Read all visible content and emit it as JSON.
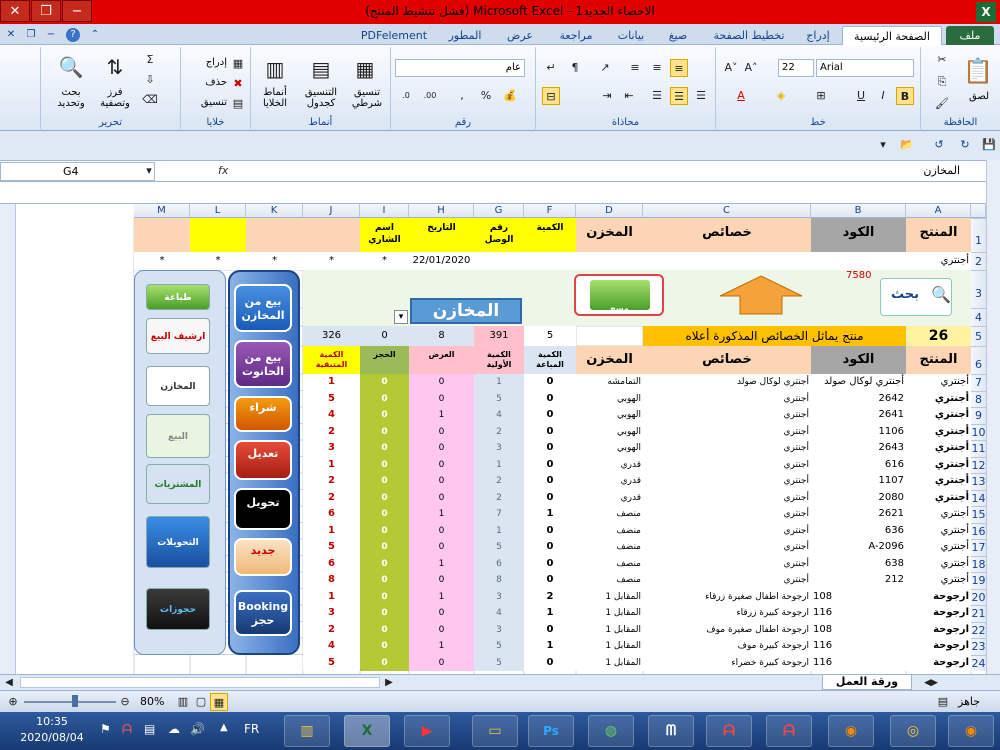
{
  "window": {
    "title": "الاحصاء الجديد1 - Microsoft Excel (فشل تنشيط المنتج)",
    "btn_close": "✕",
    "btn_restore": "❐",
    "btn_min": "−",
    "app_icon": "X"
  },
  "tabs": [
    "ملف",
    "الصفحة الرئيسية",
    "إدراج",
    "تخطيط الصفحة",
    "صيغ",
    "بيانات",
    "مراجعة",
    "عرض",
    "المطور",
    "PDFelement"
  ],
  "ribbon": {
    "clipboard": {
      "label": "الحافظة",
      "paste": "لصق"
    },
    "font": {
      "label": "خط",
      "name": "Arial",
      "size": "22"
    },
    "alignment": {
      "label": "محاذاة"
    },
    "number": {
      "label": "رقم",
      "format": "عام"
    },
    "styles": {
      "label": "أنماط",
      "cond": "تنسيق شرطي",
      "table": "التنسيق كجدول",
      "cell": "أنماط الخلايا"
    },
    "cells": {
      "label": "خلايا",
      "insert": "إدراج",
      "delete": "حذف",
      "format": "تنسيق"
    },
    "editing": {
      "label": "تحرير",
      "sort": "فرز وتصفية",
      "find": "بحث وتحديد"
    }
  },
  "formula_bar": {
    "name_box": "G4",
    "fx": "fx",
    "value": "المخازن"
  },
  "sheet": {
    "columns": [
      "A",
      "B",
      "C",
      "D",
      "F",
      "G",
      "H",
      "I",
      "J",
      "K",
      "L",
      "M"
    ],
    "row1": {
      "A": "المنتج",
      "B": "الكود",
      "C": "خصائص",
      "D": "المخزن",
      "F": "الكمية",
      "G": "رقم الوصل",
      "H": "التاريخ",
      "I": "اسم الشاري"
    },
    "row2": {
      "A": "أجنتري",
      "H": "22/01/2020",
      "I": "*",
      "J": "*",
      "K": "*",
      "L": "*",
      "M": "*"
    },
    "row3": {
      "code": "7580"
    },
    "store_title": "المخازن",
    "row5": {
      "A": "26",
      "B": "منتج يماثل الخصائص المذكورة أعلاه",
      "F": "5",
      "G": "391",
      "H": "8",
      "I": "0",
      "J": "326"
    },
    "headers": {
      "A": "المنتج",
      "B": "الكود",
      "C": "خصائص",
      "D": "المخزن",
      "F": "الكمية المباعة",
      "G": "الكمية الأولية",
      "H": "العرض",
      "I": "الحجز",
      "J": "الكمية المتبقية"
    },
    "rows": [
      {
        "n": "7",
        "A": "أجنتري",
        "B": "أجنتري لوكال صولد",
        "C": "أجنتري لوكال صولد",
        "D": "التمامشه",
        "F": "0",
        "G": "1",
        "H": "0",
        "I": "0",
        "J": "1"
      },
      {
        "n": "8",
        "A": "أجنتري",
        "B": "2642",
        "C": "أجنتري",
        "D": "الهوبي",
        "F": "0",
        "G": "5",
        "H": "0",
        "I": "0",
        "J": "5"
      },
      {
        "n": "9",
        "A": "أجنتري",
        "B": "2641",
        "C": "أجنتري",
        "D": "الهوبي",
        "F": "0",
        "G": "4",
        "H": "1",
        "I": "0",
        "J": "4"
      },
      {
        "n": "10",
        "A": "أجنتري",
        "B": "1106",
        "C": "أجنتري",
        "D": "الهوبي",
        "F": "0",
        "G": "2",
        "H": "0",
        "I": "0",
        "J": "2"
      },
      {
        "n": "11",
        "A": "أجنتري",
        "B": "2643",
        "C": "أجنتري",
        "D": "الهوبي",
        "F": "0",
        "G": "3",
        "H": "0",
        "I": "0",
        "J": "3"
      },
      {
        "n": "12",
        "A": "أجنتري",
        "B": "616",
        "C": "اجنتري",
        "D": "قدري",
        "F": "0",
        "G": "1",
        "H": "0",
        "I": "0",
        "J": "1"
      },
      {
        "n": "13",
        "A": "أجنتري",
        "B": "1107",
        "C": "أجنتري",
        "D": "قدري",
        "F": "0",
        "G": "2",
        "H": "0",
        "I": "0",
        "J": "2"
      },
      {
        "n": "14",
        "A": "أجنتري",
        "B": "2080",
        "C": "أجنتري",
        "D": "قدري",
        "F": "0",
        "G": "2",
        "H": "0",
        "I": "0",
        "J": "2"
      },
      {
        "n": "15",
        "A": "أجنتري",
        "B": "2621",
        "C": "أجنتري",
        "D": "منصف",
        "F": "1",
        "G": "7",
        "H": "1",
        "I": "0",
        "J": "6"
      },
      {
        "n": "16",
        "A": "أجنتري",
        "B": "636",
        "C": "أجنتري",
        "D": "منصف",
        "F": "0",
        "G": "1",
        "H": "0",
        "I": "0",
        "J": "1"
      },
      {
        "n": "17",
        "A": "أجنتري",
        "B": "A-2096",
        "C": "أجنتري",
        "D": "منصف",
        "F": "0",
        "G": "5",
        "H": "0",
        "I": "0",
        "J": "5"
      },
      {
        "n": "18",
        "A": "أجنتري",
        "B": "638",
        "C": "أجنتري",
        "D": "منصف",
        "F": "0",
        "G": "6",
        "H": "1",
        "I": "0",
        "J": "6"
      },
      {
        "n": "19",
        "A": "أجنتري",
        "B": "212",
        "C": "أجنتري",
        "D": "منصف",
        "F": "0",
        "G": "8",
        "H": "0",
        "I": "0",
        "J": "8"
      },
      {
        "n": "20",
        "A": "ارجوحة",
        "B": "108",
        "C": "ارجوحة اطفال صغيرة زرقاء",
        "D": "المقابل 1",
        "F": "2",
        "G": "3",
        "H": "1",
        "I": "0",
        "J": "1"
      },
      {
        "n": "21",
        "A": "ارجوحة",
        "B": "116",
        "C": "ارجوحة كبيرة زرقاء",
        "D": "المقابل 1",
        "F": "1",
        "G": "4",
        "H": "0",
        "I": "0",
        "J": "3"
      },
      {
        "n": "22",
        "A": "ارجوحة",
        "B": "108",
        "C": "ارجوحة اطفال صغيرة موف",
        "D": "المقابل 1",
        "F": "0",
        "G": "3",
        "H": "0",
        "I": "0",
        "J": "2"
      },
      {
        "n": "23",
        "A": "ارجوحة",
        "B": "116",
        "C": "ارجوحة كبيرة موف",
        "D": "المقابل 1",
        "F": "1",
        "G": "5",
        "H": "1",
        "I": "0",
        "J": "4"
      },
      {
        "n": "24",
        "A": "ارجوحة",
        "B": "116",
        "C": "ارجوحة كبيرة خضراء",
        "D": "المقابل 1",
        "F": "0",
        "G": "5",
        "H": "0",
        "I": "0",
        "J": "5"
      }
    ]
  },
  "shapes": {
    "search": "بحث",
    "clear": "مسح"
  },
  "panel": {
    "right": [
      "بيع من المخازن",
      "بيع من الحانوت",
      "شراء",
      "تعديل",
      "تحويل",
      "جديد",
      "Booking حجز"
    ],
    "left": [
      "طباعة",
      "ارشيف البيع",
      "المخازن",
      "البيع",
      "المشتريات",
      "التحويلات",
      "حجوزات"
    ]
  },
  "sheet_tab": "ورقة العمل",
  "status": {
    "ready": "جاهز",
    "zoom": "80%"
  },
  "taskbar": {
    "time": "10:35",
    "date": "2020/08/04",
    "lang": "FR"
  },
  "colors": {
    "title": "#e00000",
    "peach": "#fcd5b4",
    "yellow": "#ffff00",
    "gray_hdr": "#a6a6a6",
    "green_hdr": "#9bbb59",
    "pink": "#ffc0cb",
    "lightblue": "#dbe5f1"
  }
}
